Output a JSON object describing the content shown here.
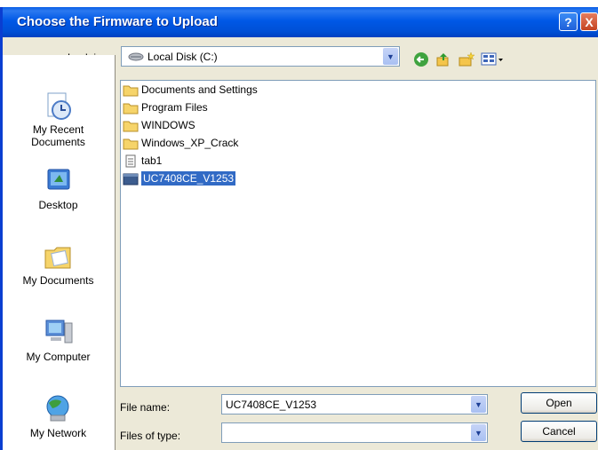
{
  "dialog": {
    "title": "Choose the Firmware to Upload",
    "help_glyph": "?",
    "close_glyph": "X"
  },
  "look_in": {
    "label": "Look in:",
    "value": "Local Disk (C:)"
  },
  "places": [
    {
      "label": "My Recent\nDocuments"
    },
    {
      "label": "Desktop"
    },
    {
      "label": "My Documents"
    },
    {
      "label": "My Computer"
    },
    {
      "label": "My Network"
    }
  ],
  "files": [
    {
      "name": "Documents and Settings",
      "type": "folder"
    },
    {
      "name": "Program Files",
      "type": "folder"
    },
    {
      "name": "WINDOWS",
      "type": "folder"
    },
    {
      "name": "Windows_XP_Crack",
      "type": "folder"
    },
    {
      "name": "tab1",
      "type": "text"
    },
    {
      "name": "UC7408CE_V1253",
      "type": "file",
      "selected": true
    }
  ],
  "file_name": {
    "label": "File name:",
    "value": "UC7408CE_V1253"
  },
  "file_type": {
    "label": "Files of type:",
    "value": ""
  },
  "buttons": {
    "open": "Open",
    "cancel": "Cancel"
  }
}
